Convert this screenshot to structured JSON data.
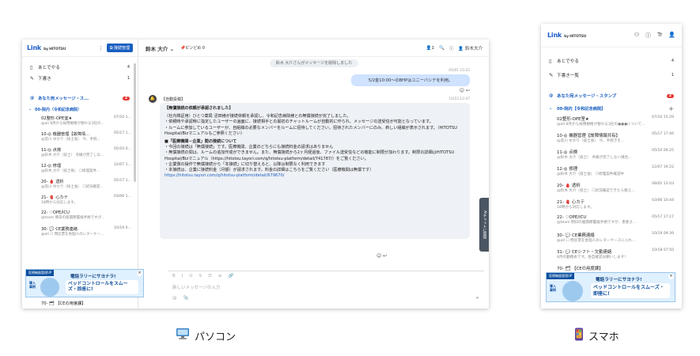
{
  "pc": {
    "logo": "Link",
    "logo_sub": "by HITOTSU",
    "admin_button": "接続管理",
    "nav": [
      {
        "icon": "bookmark-icon",
        "label": "あとでやる",
        "count": "4"
      },
      {
        "icon": "pencil-icon",
        "label": "下書き",
        "count": "1"
      }
    ],
    "mention_section": {
      "label": "あなた宛メッセージ・ス...",
      "count": "2"
    },
    "group": "00-院内（令和記念病院）",
    "rooms": [
      {
        "name": "02整形-OPE室★",
        "time": "07/10 1...",
        "preview": "@all 8月から採用規格が替わる3社の..."
      },
      {
        "name": "10-◎ 機器管理【故障情...",
        "time": "05/17 1...",
        "preview": "@及川 ゆかり（技士長） 今、手続..."
      },
      {
        "name": "11-◎ 点検",
        "time": "05/10 0...",
        "preview": "@鈴木 大介（技士） 点検が完了しな..."
      },
      {
        "name": "12-◎ 修理",
        "time": "12/07 1...",
        "preview": "@鈴木 大介（技士長） ☐修理案件..."
      },
      {
        "name": "20- 🩸 透析",
        "time": "05/17 1...",
        "preview": "@及川 ゆかり（技士長） ☐状況確認..."
      },
      {
        "name": "21- 🫀 心カテ",
        "time": "03/06 1...",
        "preview": "18時から対応します。"
      },
      {
        "name": "22- ♡OPE/ICU",
        "time": "",
        "preview": "@team 明日の股関節置換手術ですが..."
      },
      {
        "name": "30- 💬 CE業務連絡",
        "time": "10/19 0...",
        "preview": "@all ☐ 問診票を各個人のレターケー..."
      }
    ],
    "last_room": "70- 🗂 【CEの用度課】",
    "header": {
      "name": "鈴木 大介 ⌄",
      "pin": "📌ピンどめ 0",
      "members": "1",
      "user": "鈴木大介"
    },
    "system_msg": "鈴木 大介さんがメッセージを削除しました",
    "my_msg": {
      "time": "05/01 15:22",
      "text": "5/2金10:00〜のBHPはユニーバシテを利用。"
    },
    "auto": {
      "label": "【自動投稿】",
      "time": "10/23 12:47",
      "title": "【無償接続の依頼が承認されました】",
      "lines": [
        "（社内検証用）ひとつ薬局 沼田様が接続依頼を承認し、令和記念病院様との無償接続が完了しました。",
        "・依頼時や承認時に指定したユーザーの画面に、接続相手との最初のチャットルームが自動的に作られ、メッセージの送受信が可能となっています。",
        "・ルームに参加しているユーザーが、自組織の必要なメンバーをルームに招待してください。招待されたメンバーにのみ、新しい組織が表示されます。（HITOTSU Hospital/Bizマニュアルもご参照ください）",
        "■「医療機関－企業」間の接続について",
        "・今回の接続は「無償接続」です。医療機関、企業のどちらにも接続料金の請求はありません",
        "・無償接続の間は、ルームの追加作成ができません。また、無償接続から2ヶ月経過後、ファイル送受信などの機能に制限が加わります。制限の詳細はHITOTSU Hospital/Bizマニュアル（https://hitotsu.tayori.com/q/hitotsu-platform/detail/741787/）をご覧ください。",
        "・企業側の操作で無償接続から「本接続」に切り替えると、以降は制限なく利用できます",
        "・本接続は、企業に接続料金（月額）が請求されます。料金の詳細はこちらをご覧ください（医療機関は無償です）",
        "https://hitotsu.tayori.com/q/hitotsu-platform/detail/679670/"
      ]
    },
    "ai_tab": "AIチャットに質問",
    "input_placeholder": "新しいメッセージの入力",
    "ad": {
      "tag": "医療機器管理UP",
      "line1": "電話ラリーにサヨナラ!",
      "line2": "ベッドコントロールをスムーズ・即座に!",
      "side": "導入事例"
    }
  },
  "mobile": {
    "logo": "Link",
    "logo_sub": "by HITOTSU",
    "nav": [
      {
        "icon": "bookmark-icon",
        "label": "あとでやる",
        "count": "4"
      },
      {
        "icon": "pencil-icon",
        "label": "下書き一覧",
        "count": "1"
      }
    ],
    "mention_section": {
      "label": "あなた宛メッセージ・スタンプ",
      "count": "2"
    },
    "group": "00-院内【令和記念病院】",
    "rooms": [
      {
        "name": "02整形-OPE室★",
        "time": "07/10 15:29",
        "preview": "@all 8月から採用規格が替わる3社の●●●について..."
      },
      {
        "name": "10-◎ 機器管理【故障情報共有】",
        "time": "05/17 17:46",
        "preview": "@及川 ゆかり（技士長） 今、手続きを..."
      },
      {
        "name": "11-◎ 点検",
        "time": "05/10 09:25",
        "preview": "@鈴木 大介（技士） 点検が完了しない場合..."
      },
      {
        "name": "12-◎ 修理",
        "time": "12/07 19:22",
        "preview": "@鈴木 大介（技士長） ☐修理案件確認中"
      },
      {
        "name": "20- 🩸 透析",
        "time": "08/02 13:03",
        "preview": "@鈴木 大介（技士） ☐状況確認できたら教え..."
      },
      {
        "name": "21- 🫀 心カテ",
        "time": "03/06 10:44",
        "preview": "18時から対応します。"
      },
      {
        "name": "22- ♡OPE/ICU",
        "time": "05/17 17:17",
        "preview": "@team 明日の股関節置換手術ですが、患者さ..."
      },
      {
        "name": "30- 💬 CE業務連絡",
        "time": "10/19 09:39",
        "preview": "@all ☐ 問診票を各個人のレターケースに入れ..."
      },
      {
        "name": "31- 💬 CEシフト・欠勤連絡",
        "time": "10/18 07:50",
        "preview": "8月の勤務表です。各自確認お願いします！"
      },
      {
        "name": "70- 🗂 【CEの用度課】",
        "time": "",
        "preview": ""
      }
    ],
    "ad": {
      "tag": "医療機器管理UP",
      "line1": "電話ラリーにサヨナラ!",
      "line2": "ベッドコントロールをスムーズ・即座に!",
      "side": "導入事例"
    }
  },
  "captions": {
    "pc": "パソコン",
    "mobile": "スマホ"
  }
}
